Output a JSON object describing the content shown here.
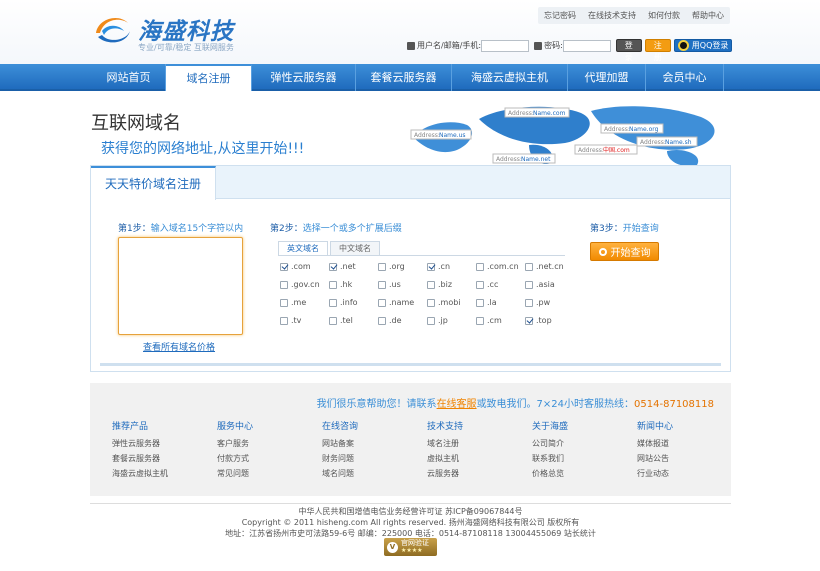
{
  "header": {
    "brand_name": "海盛科技",
    "slogan": "专业/可靠/稳定 互联网服务",
    "top_links": [
      "忘记密码",
      "在线技术支持",
      "如何付款",
      "帮助中心"
    ],
    "login": {
      "username_label": "用户名/邮箱/手机:",
      "password_label": "密码:",
      "login_button": "登录",
      "register_button": "注册",
      "qq_button": "用QQ登录"
    }
  },
  "nav": {
    "items": [
      {
        "label": "网站首页",
        "w": 74
      },
      {
        "label": "域名注册",
        "w": 86
      },
      {
        "label": "弹性云服务器",
        "w": 104
      },
      {
        "label": "套餐云服务器",
        "w": 96
      },
      {
        "label": "海盛云虚拟主机",
        "w": 116
      },
      {
        "label": "代理加盟",
        "w": 78
      },
      {
        "label": "会员中心",
        "w": 78
      }
    ],
    "active": "域名注册"
  },
  "hero": {
    "title": "互联网域名",
    "subtitle": "获得您的网络地址,从这里开始!!!",
    "map_labels": [
      {
        "prefix": "Address:",
        "name": "Name.com"
      },
      {
        "prefix": "Address:",
        "name": "Name.us"
      },
      {
        "prefix": "Address:",
        "name": "Name.org"
      },
      {
        "prefix": "Address:",
        "name": "中国.com"
      },
      {
        "prefix": "Address:",
        "name": "Name.sh"
      },
      {
        "prefix": "Address:",
        "name": "Name.net"
      }
    ]
  },
  "panel": {
    "tab_label": "天天特价域名注册",
    "step1": {
      "label": "第1步：",
      "hint": "输入域名15个字符以内"
    },
    "step2": {
      "label": "第2步：",
      "hint": "选择一个或多个扩展后缀"
    },
    "step3": {
      "label": "第3步：",
      "hint": "开始查询"
    },
    "ext_tabs": [
      "英文域名",
      "中文域名"
    ],
    "active_ext_tab": "英文域名",
    "extensions": [
      {
        "ext": ".com",
        "checked": true
      },
      {
        "ext": ".net",
        "checked": true
      },
      {
        "ext": ".org",
        "checked": false
      },
      {
        "ext": ".cn",
        "checked": true
      },
      {
        "ext": ".com.cn",
        "checked": false
      },
      {
        "ext": ".net.cn",
        "checked": false
      },
      {
        "ext": ".gov.cn",
        "checked": false
      },
      {
        "ext": ".hk",
        "checked": false
      },
      {
        "ext": ".us",
        "checked": false
      },
      {
        "ext": ".biz",
        "checked": false
      },
      {
        "ext": ".cc",
        "checked": false
      },
      {
        "ext": ".asia",
        "checked": false
      },
      {
        "ext": ".me",
        "checked": false
      },
      {
        "ext": ".info",
        "checked": false
      },
      {
        "ext": ".name",
        "checked": false
      },
      {
        "ext": ".mobi",
        "checked": false
      },
      {
        "ext": ".la",
        "checked": false
      },
      {
        "ext": ".pw",
        "checked": false
      },
      {
        "ext": ".tv",
        "checked": false
      },
      {
        "ext": ".tel",
        "checked": false
      },
      {
        "ext": ".de",
        "checked": false
      },
      {
        "ext": ".jp",
        "checked": false
      },
      {
        "ext": ".cm",
        "checked": false
      },
      {
        "ext": ".top",
        "checked": true
      }
    ],
    "search_button": "开始查询",
    "all_prices_link": "查看所有域名价格"
  },
  "footer": {
    "help_prefix": "我们很乐意帮助您！请联系",
    "help_link": "在线客服",
    "help_mid": "或致电我们。7×24小时客服热线：",
    "hotline": "0514-87108118",
    "columns": [
      {
        "title": "推荐产品",
        "items": [
          "弹性云服务器",
          "套餐云服务器",
          "海盛云虚拟主机"
        ]
      },
      {
        "title": "服务中心",
        "items": [
          "客户服务",
          "付款方式",
          "常见问题"
        ]
      },
      {
        "title": "在线咨询",
        "items": [
          "网站备案",
          "财务问题",
          "域名问题"
        ]
      },
      {
        "title": "技术支持",
        "items": [
          "域名注册",
          "虚拟主机",
          "云服务器"
        ]
      },
      {
        "title": "关于海盛",
        "items": [
          "公司简介",
          "联系我们",
          "价格总览"
        ]
      },
      {
        "title": "新闻中心",
        "items": [
          "媒体报道",
          "网站公告",
          "行业动态"
        ]
      }
    ],
    "license": "中华人民共和国增值电信业务经营许可证 苏ICP备09067844号",
    "copyright": "Copyright © 2011 hisheng.com All rights reserved. 扬州海盛网络科技有限公司 版权所有",
    "address": "地址：江苏省扬州市史可法路59-6号 邮编：225000 电话：0514-87108118 13004455069 站长统计",
    "badge_text": "官网验证",
    "badge_stars": "★★★★"
  }
}
